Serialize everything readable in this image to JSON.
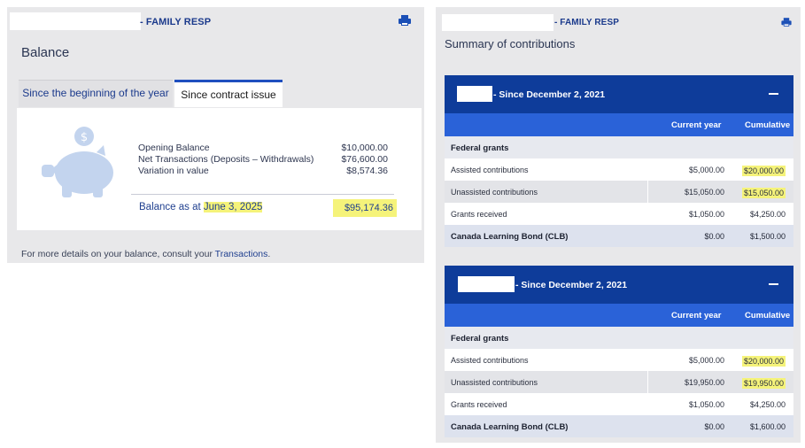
{
  "left": {
    "header": {
      "family_resp": "- FAMILY RESP",
      "print_icon": "printer-icon"
    },
    "title": "Balance",
    "tabs": [
      {
        "label": "Since the beginning of the year",
        "active": false
      },
      {
        "label": "Since contract issue",
        "active": true
      }
    ],
    "balance": {
      "opening_label": "Opening Balance",
      "opening_value": "$10,000.00",
      "net_label": "Net Transactions (Deposits – Withdrawals)",
      "net_value": "$76,600.00",
      "variation_label": "Variation in value",
      "variation_value": "$8,574.36",
      "asat_prefix": "Balance as at ",
      "asat_date": "June 3, 2025",
      "asat_value": "$95,174.36"
    },
    "footnote_prefix": "For more details on your balance, consult your ",
    "footnote_link": "Transactions",
    "footnote_suffix": "."
  },
  "right": {
    "header": {
      "family_resp": "- FAMILY RESP",
      "print_icon": "printer-icon"
    },
    "title": "Summary of contributions",
    "col_current": "Current year",
    "col_cumulative": "Cumulative",
    "blocks": [
      {
        "since": "- Since December 2, 2021",
        "federal": "Federal grants",
        "rows": [
          {
            "label": "Assisted contributions",
            "current": "$5,000.00",
            "cumulative": "$20,000.00"
          },
          {
            "label": "Unassisted contributions",
            "current": "$15,050.00",
            "cumulative": "$15,050.00"
          },
          {
            "label": "Grants received",
            "current": "$1,050.00",
            "cumulative": "$4,250.00"
          }
        ],
        "clb": {
          "label": "Canada Learning Bond (CLB)",
          "current": "$0.00",
          "cumulative": "$1,500.00"
        }
      },
      {
        "since": "- Since December 2, 2021",
        "federal": "Federal grants",
        "rows": [
          {
            "label": "Assisted contributions",
            "current": "$5,000.00",
            "cumulative": "$20,000.00"
          },
          {
            "label": "Unassisted contributions",
            "current": "$19,950.00",
            "cumulative": "$19,950.00"
          },
          {
            "label": "Grants received",
            "current": "$1,050.00",
            "cumulative": "$4,250.00"
          }
        ],
        "clb": {
          "label": "Canada Learning Bond (CLB)",
          "current": "$0.00",
          "cumulative": "$1,600.00"
        }
      }
    ]
  },
  "colors": {
    "nav_dark": "#0e3c9a",
    "nav_mid": "#2a62d8",
    "highlight": "#f5f37a",
    "link": "#1f3f8f"
  }
}
